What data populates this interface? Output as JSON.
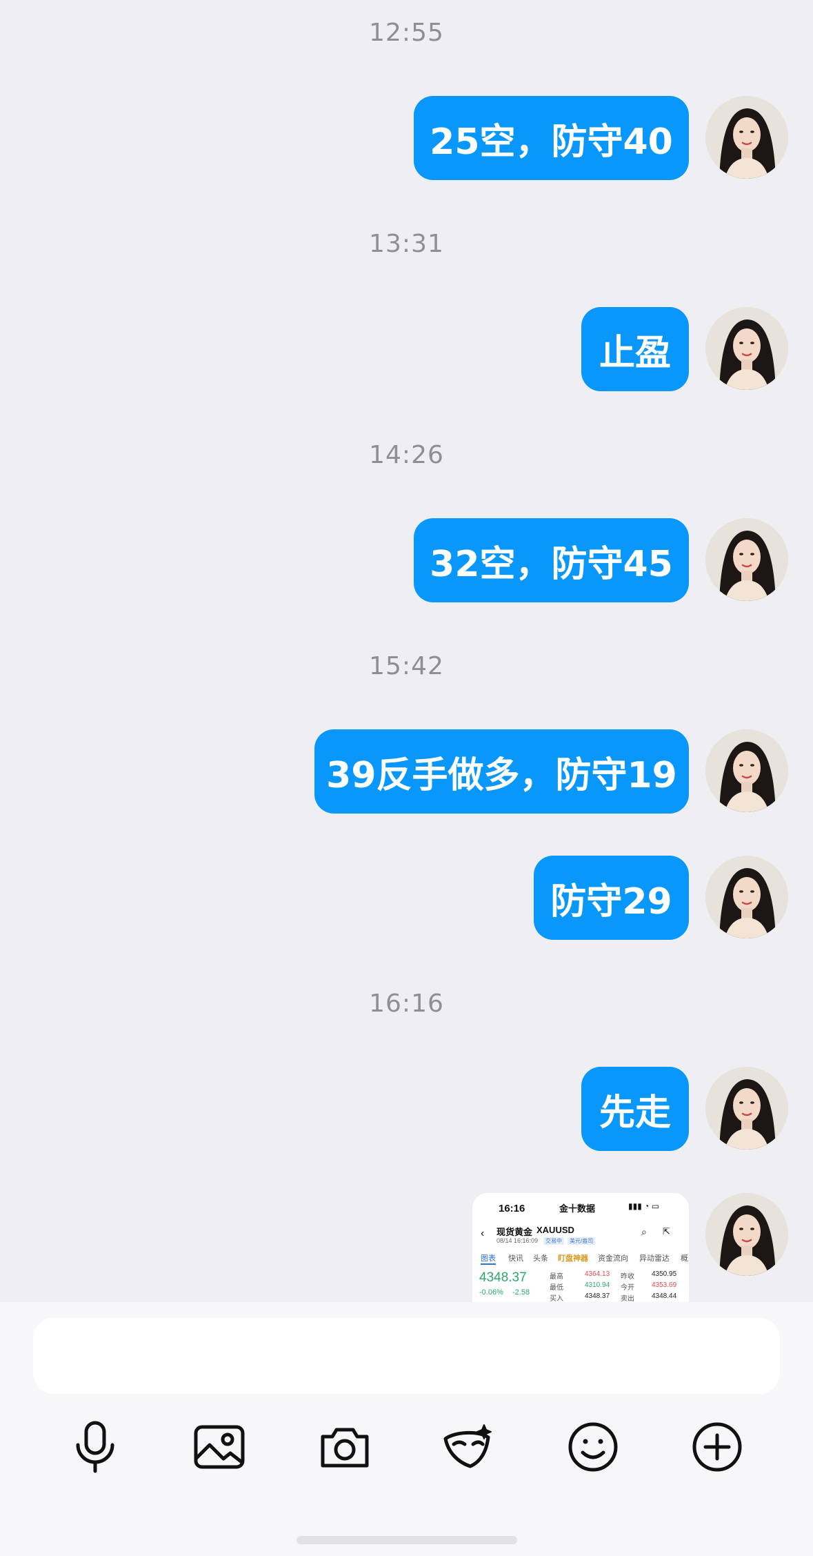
{
  "messages": [
    {
      "time": "12:55",
      "text": "25空，防守40"
    },
    {
      "time": "13:31",
      "text": "止盈"
    },
    {
      "time": "14:26",
      "text": "32空，防守45"
    },
    {
      "time": "15:42",
      "text": "39反手做多，防守19"
    },
    {
      "text": "防守29"
    },
    {
      "time": "16:16",
      "text": "先走"
    }
  ],
  "image_message": {
    "status_time": "16:16",
    "app_name": "金十数据",
    "title": "现货黄金",
    "symbol": "XAUUSD",
    "subtitle_time": "08/14 16:16:09",
    "badge1": "交易中",
    "badge2": "美元/盎司",
    "tabs": [
      "图表",
      "快讯",
      "头条",
      "盯盘神器",
      "资金流向",
      "异动雷达",
      "概"
    ],
    "price": "4348.37",
    "change_pct": "-0.06%",
    "change": "-2.58",
    "stats": [
      {
        "label": "最高",
        "value": "4364.13",
        "label2": "昨收",
        "value2": "4350.95"
      },
      {
        "label": "最低",
        "value": "4310.94",
        "label2": "今开",
        "value2": "4353.69"
      },
      {
        "label": "买入",
        "value": "4348.37",
        "label2": "卖出",
        "value2": "4348.44"
      }
    ]
  },
  "colors": {
    "bubble": "#0a97fb",
    "background": "#efeff3",
    "up": "#e24a4a",
    "down": "#2aa869"
  },
  "icons": [
    "microphone-icon",
    "image-icon",
    "camera-icon",
    "mask-icon",
    "emoji-icon",
    "plus-icon"
  ]
}
